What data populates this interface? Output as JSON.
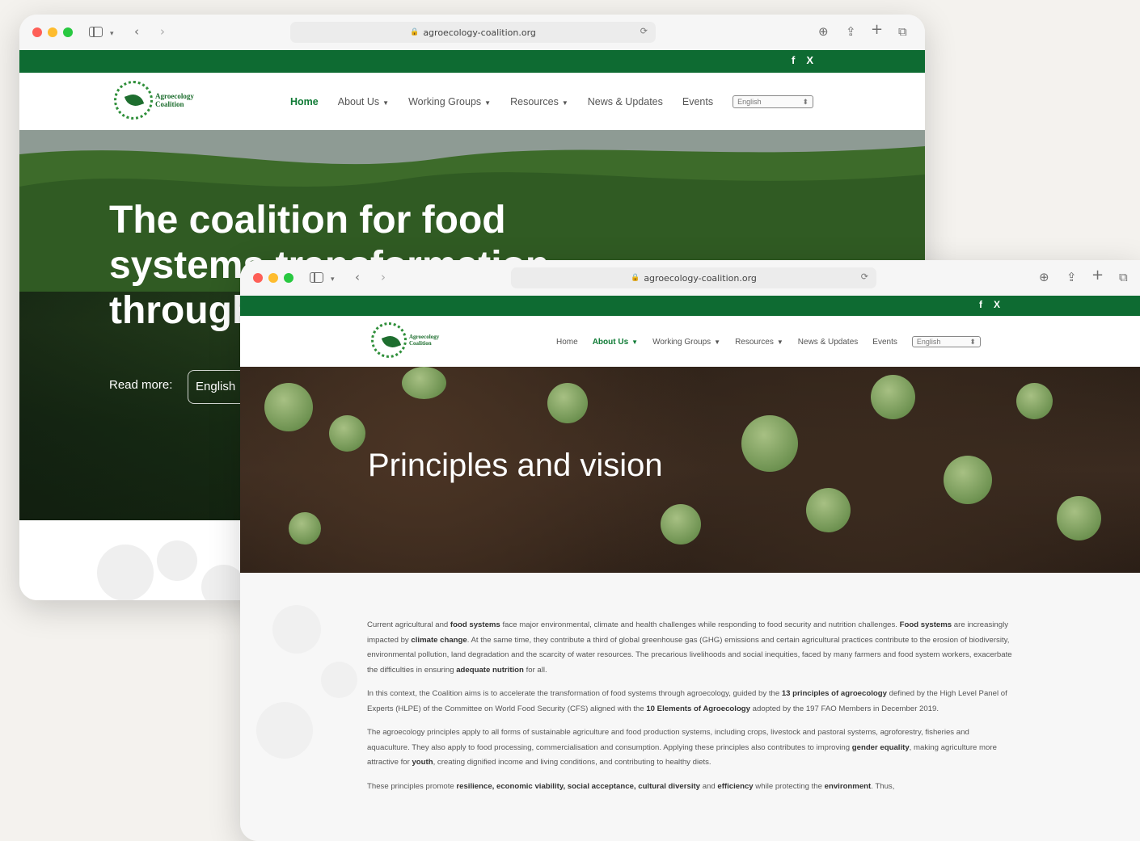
{
  "back": {
    "url": "agroecology-coalition.org",
    "nav": [
      {
        "label": "Home",
        "caret": false,
        "active": true
      },
      {
        "label": "About Us",
        "caret": true,
        "active": false
      },
      {
        "label": "Working Groups",
        "caret": true,
        "active": false
      },
      {
        "label": "Resources",
        "caret": true,
        "active": false
      },
      {
        "label": "News & Updates",
        "caret": false,
        "active": false
      },
      {
        "label": "Events",
        "caret": false,
        "active": false
      }
    ],
    "language": "English",
    "hero_title": "The coalition for food systems transformation through agroecology",
    "read_more": "Read more:",
    "read_more_select": "English"
  },
  "front": {
    "url": "agroecology-coalition.org",
    "nav": [
      {
        "label": "Home",
        "caret": false,
        "active": false
      },
      {
        "label": "About Us",
        "caret": true,
        "active": true
      },
      {
        "label": "Working Groups",
        "caret": true,
        "active": false
      },
      {
        "label": "Resources",
        "caret": true,
        "active": false
      },
      {
        "label": "News & Updates",
        "caret": false,
        "active": false
      },
      {
        "label": "Events",
        "caret": false,
        "active": false
      }
    ],
    "language": "English",
    "hero_title": "Principles and vision"
  },
  "logo": {
    "line1": "Agroecology",
    "line2": "Coalition"
  },
  "social": {
    "facebook": "f",
    "x": "X"
  },
  "paragraphs": [
    [
      {
        "t": "Current agricultural and "
      },
      {
        "t": "food systems",
        "b": true
      },
      {
        "t": " face major environmental, climate and health challenges while responding to food security and nutrition challenges. "
      },
      {
        "t": "Food systems",
        "b": true
      },
      {
        "t": " are increasingly impacted by "
      },
      {
        "t": "climate change",
        "b": true
      },
      {
        "t": ". At the same time, they contribute a third of global greenhouse gas (GHG) emissions and certain agricultural practices contribute to the erosion of biodiversity, environmental pollution, land degradation and the scarcity of water resources. The precarious livelihoods and social inequities, faced by many farmers and food system workers, exacerbate the difficulties in ensuring "
      },
      {
        "t": "adequate nutrition",
        "b": true
      },
      {
        "t": " for all."
      }
    ],
    [
      {
        "t": "In this context, the Coalition aims is to accelerate the transformation of food systems through agroecology, guided by the "
      },
      {
        "t": "13 principles of agroecology",
        "b": true
      },
      {
        "t": " defined by the High Level Panel of Experts (HLPE) of the Committee on World Food Security (CFS) aligned with the "
      },
      {
        "t": "10 Elements of Agroecology",
        "b": true
      },
      {
        "t": " adopted by the 197 FAO Members in December 2019."
      }
    ],
    [
      {
        "t": "The agroecology principles apply to all forms of sustainable agriculture and food production systems, including crops, livestock and pastoral systems, agroforestry, fisheries and aquaculture. They also apply to food processing, commercialisation and consumption. Applying these principles also contributes to improving "
      },
      {
        "t": "gender equality",
        "b": true
      },
      {
        "t": ", making agriculture more attractive for "
      },
      {
        "t": "youth",
        "b": true
      },
      {
        "t": ", creating dignified income and living conditions, and contributing to healthy diets."
      }
    ],
    [
      {
        "t": "These principles promote "
      },
      {
        "t": "resilience, economic viability, social acceptance, cultural diversity",
        "b": true
      },
      {
        "t": " and "
      },
      {
        "t": "efficiency",
        "b": true
      },
      {
        "t": " while protecting the "
      },
      {
        "t": "environment",
        "b": true
      },
      {
        "t": ". Thus,"
      }
    ]
  ]
}
